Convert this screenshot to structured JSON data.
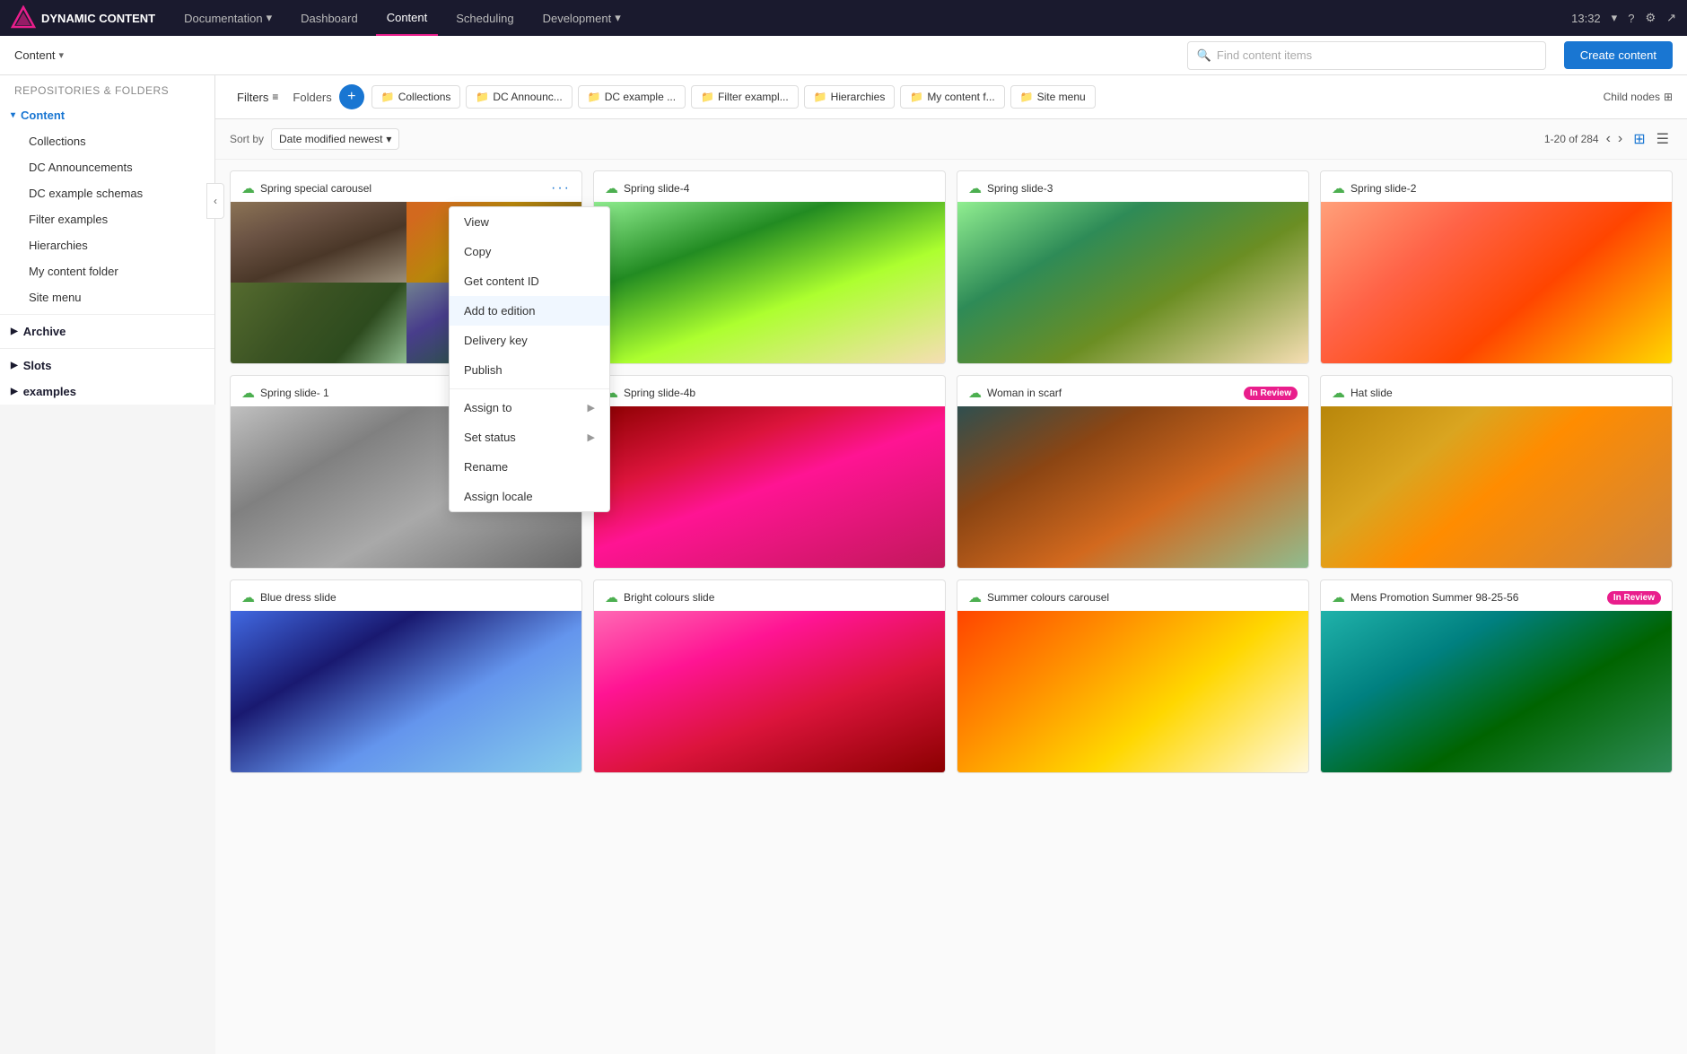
{
  "app": {
    "name": "DYNAMIC CONTENT",
    "logo_alt": "DC Logo"
  },
  "topnav": {
    "items": [
      {
        "label": "Documentation",
        "has_arrow": true
      },
      {
        "label": "Dashboard"
      },
      {
        "label": "Content",
        "active": true
      },
      {
        "label": "Scheduling"
      },
      {
        "label": "Development",
        "has_arrow": true
      }
    ],
    "time": "13:32",
    "search_placeholder": "Find content items"
  },
  "subheader": {
    "content_label": "Content",
    "create_label": "Create content"
  },
  "sidebar": {
    "repos_label": "Repositories & folders",
    "content_item": "Content",
    "collections": "Collections",
    "dc_announcements": "DC Announcements",
    "dc_example_schemas": "DC example schemas",
    "filter_examples": "Filter examples",
    "hierarchies": "Hierarchies",
    "my_content_folder": "My content folder",
    "site_menu": "Site menu",
    "archive": "Archive",
    "slots": "Slots",
    "examples": "examples"
  },
  "toolbar": {
    "filters_label": "Filters",
    "folders_label": "Folders",
    "child_nodes_label": "Child nodes",
    "folder_tabs": [
      {
        "label": "Collections"
      },
      {
        "label": "DC Announc..."
      },
      {
        "label": "DC example ..."
      },
      {
        "label": "Filter exampl..."
      },
      {
        "label": "Hierarchies"
      },
      {
        "label": "My content f..."
      },
      {
        "label": "Site menu"
      }
    ]
  },
  "sort_bar": {
    "sort_label": "Sort by",
    "sort_value": "Date modified newest",
    "pagination": "1-20 of 284",
    "prev_label": "‹",
    "next_label": "›"
  },
  "context_menu": {
    "items": [
      {
        "label": "View",
        "has_sub": false
      },
      {
        "label": "Copy",
        "has_sub": false
      },
      {
        "label": "Get content ID",
        "has_sub": false
      },
      {
        "label": "Add to edition",
        "has_sub": false
      },
      {
        "label": "Delivery key",
        "has_sub": false
      },
      {
        "label": "Publish",
        "has_sub": false
      },
      {
        "divider": true
      },
      {
        "label": "Assign to",
        "has_sub": true
      },
      {
        "label": "Set status",
        "has_sub": true
      },
      {
        "label": "Rename",
        "has_sub": false
      },
      {
        "label": "Assign locale",
        "has_sub": false
      }
    ]
  },
  "content_cards": [
    {
      "title": "Spring special carousel",
      "status": "",
      "img_class": "spring-special",
      "menu": true
    },
    {
      "title": "Spring slide-4",
      "status": "",
      "img_class": "spring4"
    },
    {
      "title": "Spring slide-3",
      "status": "",
      "img_class": "spring3"
    },
    {
      "title": "Spring slide-2",
      "status": "",
      "img_class": "spring2"
    },
    {
      "title": "Spring slide- 1",
      "status": "",
      "img_class": "spring1"
    },
    {
      "title": "Spring slide-4b",
      "status": "",
      "img_class": "spring4b"
    },
    {
      "title": "Woman in scarf",
      "status": "In Review",
      "img_class": "woman-scarf"
    },
    {
      "title": "Hat slide",
      "status": "",
      "img_class": "hat"
    },
    {
      "title": "Blue dress slide",
      "status": "",
      "img_class": "blue-dress"
    },
    {
      "title": "Bright colours slide",
      "status": "",
      "img_class": "bright"
    },
    {
      "title": "Summer colours carousel",
      "status": "",
      "img_class": "summer"
    },
    {
      "title": "Mens Promotion Summer 98-25-56",
      "status": "In Review",
      "img_class": "mens"
    }
  ]
}
